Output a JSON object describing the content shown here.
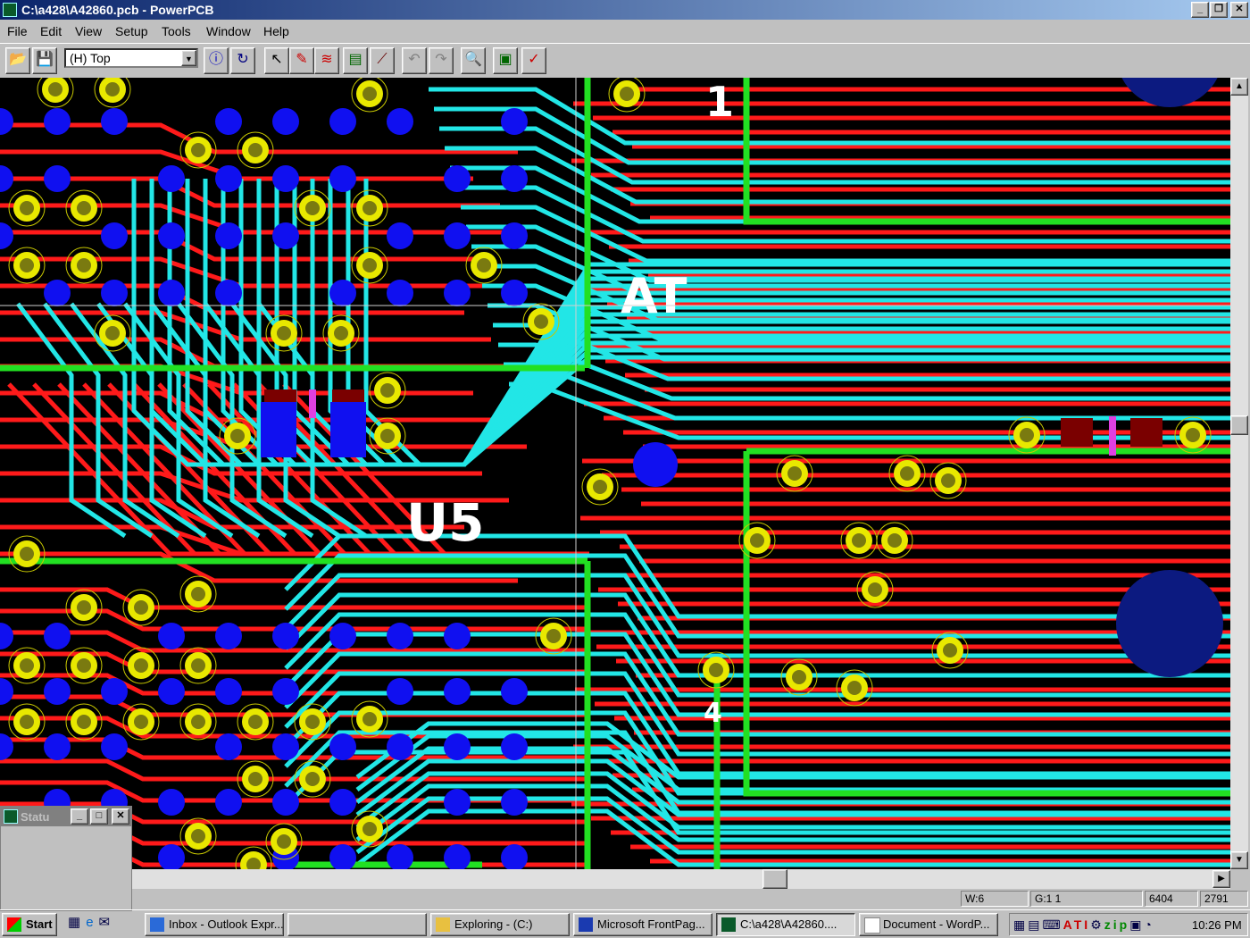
{
  "window": {
    "title": "C:\\a428\\A42860.pcb - PowerPCB"
  },
  "menu": [
    "File",
    "Edit",
    "View",
    "Setup",
    "Tools",
    "Window",
    "Help"
  ],
  "toolbar": {
    "layer_value": "(H) Top"
  },
  "status": {
    "width": "W:6",
    "grid": "G:1 1",
    "x": "6404",
    "y": "2791"
  },
  "status_window": {
    "title": "Statu"
  },
  "taskbar": {
    "start": "Start",
    "tasks": [
      "Inbox - Outlook Expr...",
      "",
      "Exploring - (C:)",
      "Microsoft FrontPag...",
      "C:\\a428\\A42860....",
      "Document - WordP..."
    ],
    "clock": "10:26 PM"
  },
  "silkscreen": [
    "1",
    "AT",
    "4",
    "U5"
  ],
  "colors": {
    "background": "#000000",
    "top_trace": "#ff1a1a",
    "bottom_trace": "#22e6e6",
    "board_outline": "#22e022",
    "via_pad": "#1010f0",
    "through_pad": "#e8e800",
    "pad_hole": "#7a7a10"
  }
}
